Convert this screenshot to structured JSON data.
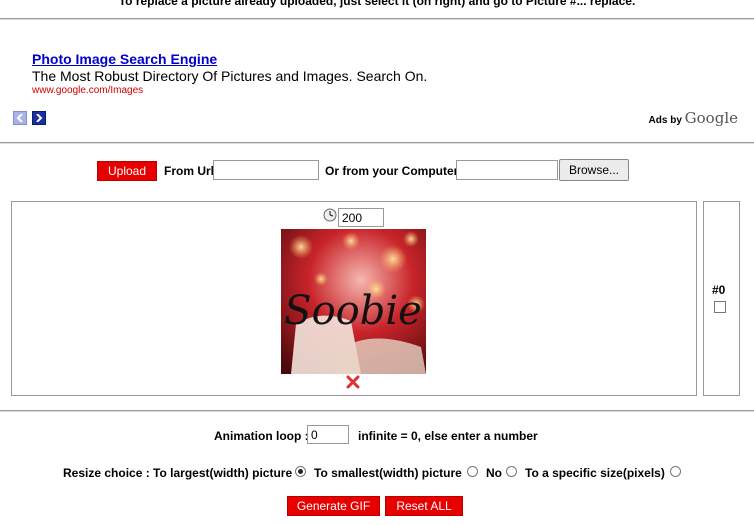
{
  "header": {
    "note": "To replace a picture already uploaded, just select it (on right) and go to Picture #... replace."
  },
  "ad": {
    "title": "Photo Image Search Engine",
    "description": "The Most Robust Directory Of Pictures and Images. Search On.",
    "url": "www.google.com/Images",
    "ads_by": "Ads by",
    "google": "Google"
  },
  "upload": {
    "upload_label": "Upload",
    "from_url_label": "From Url",
    "url_value": "",
    "from_computer_label": "Or from your Computer",
    "file_value": "",
    "browse_label": "Browse..."
  },
  "frame": {
    "delay": "200",
    "image_text": "Soobie",
    "number_label": "#0"
  },
  "options": {
    "loop_label": "Animation loop :",
    "loop_value": "0",
    "loop_hint": "infinite = 0, else enter a number",
    "resize_label": "Resize choice : To largest(width) picture",
    "smallest_label": "To smallest(width) picture",
    "no_label": "No",
    "specific_label": "To a specific size(pixels)"
  },
  "actions": {
    "generate_label": "Generate GIF",
    "reset_label": "Reset ALL"
  },
  "colors": {
    "button_red": "#e60000",
    "link_blue": "#0000cc"
  }
}
